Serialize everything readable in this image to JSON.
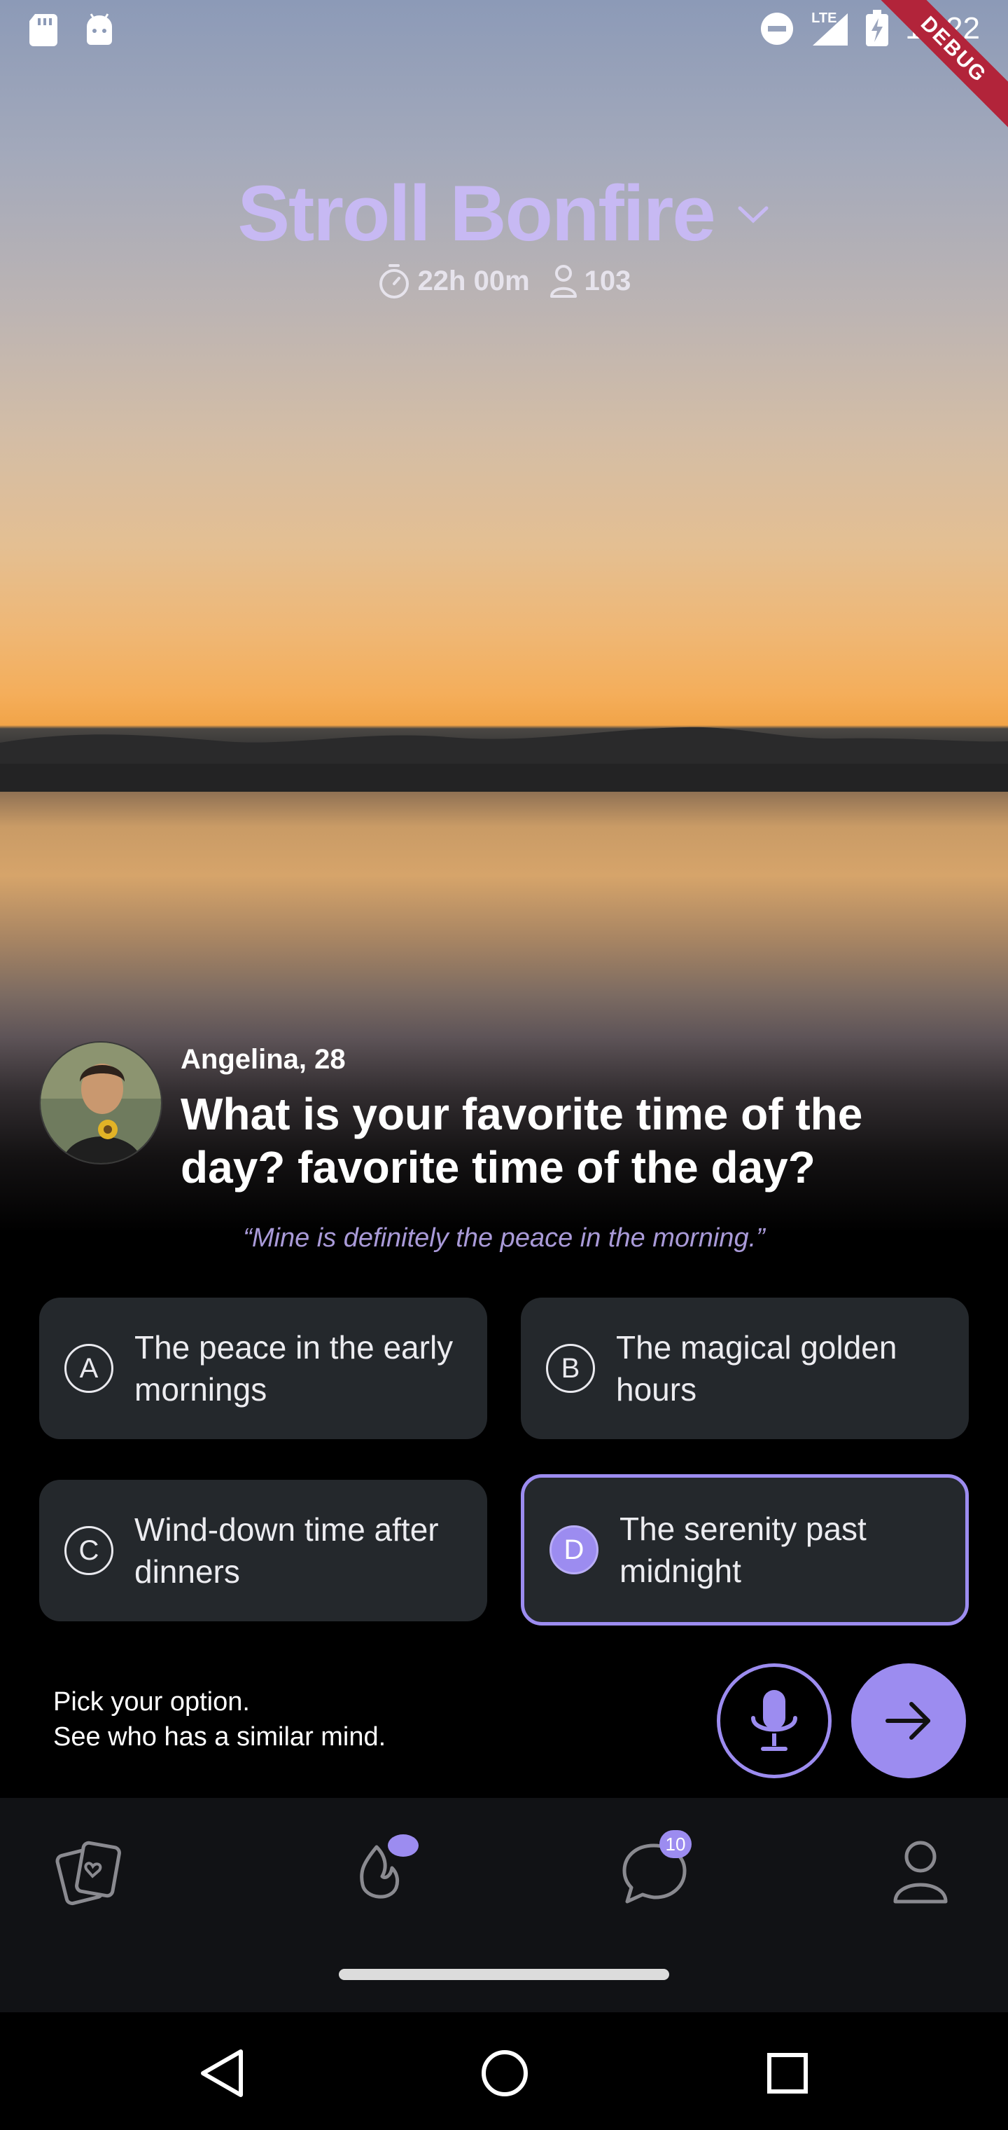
{
  "status_bar": {
    "time": "11:22",
    "debug_label": "DEBUG",
    "network_label": "LTE",
    "left_icons": [
      "sd-card-icon",
      "android-icon"
    ],
    "right_icons": [
      "do-not-disturb-icon",
      "signal-icon",
      "battery-charging-icon"
    ]
  },
  "room": {
    "title": "Stroll Bonfire",
    "timer": "22h 00m",
    "participants": "103"
  },
  "question": {
    "author": "Angelina, 28",
    "text": "What is your favorite time of the day? favorite time of the day?",
    "quote": "“Mine is definitely the peace in the morning.”"
  },
  "options": [
    {
      "letter": "A",
      "text": "The peace in the early mornings",
      "selected": false
    },
    {
      "letter": "B",
      "text": "The magical golden hours",
      "selected": false
    },
    {
      "letter": "C",
      "text": "Wind-down time after dinners",
      "selected": false
    },
    {
      "letter": "D",
      "text": "The serenity past midnight",
      "selected": true
    }
  ],
  "footer": {
    "hint_line1": "Pick your option.",
    "hint_line2": "See who has a similar mind."
  },
  "bottom_nav": {
    "items": [
      {
        "name": "cards",
        "icon": "cards-icon"
      },
      {
        "name": "bonfire",
        "icon": "flame-icon"
      },
      {
        "name": "chats",
        "icon": "chat-icon",
        "badge": "10"
      },
      {
        "name": "profile",
        "icon": "user-icon"
      }
    ]
  },
  "colors": {
    "accent": "#9c8cf0",
    "title": "#c7b9f3",
    "option_bg": "#24282c",
    "nav_bg": "#111215"
  }
}
